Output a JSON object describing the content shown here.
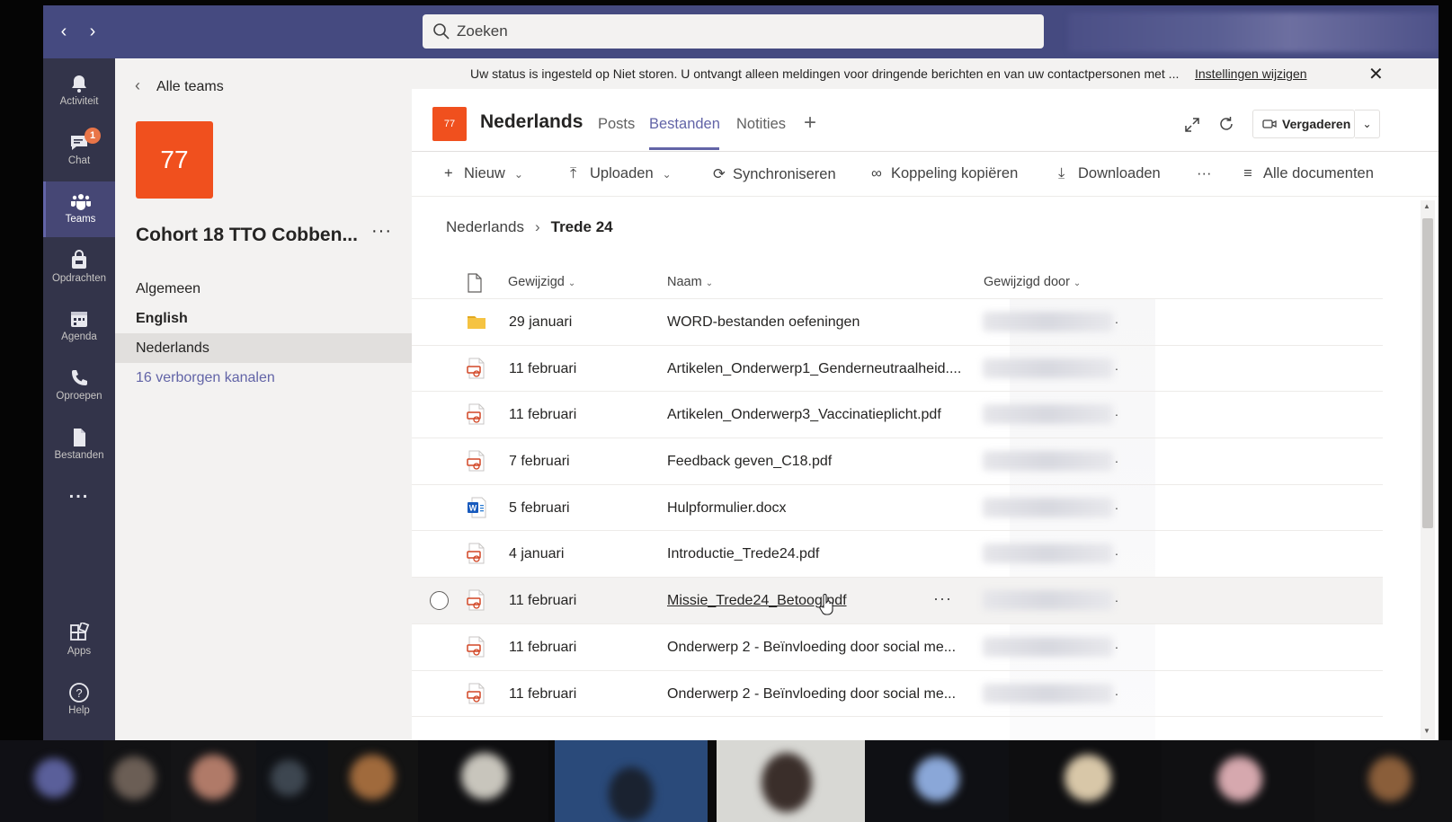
{
  "search": {
    "placeholder": "Zoeken"
  },
  "rail": {
    "items": [
      {
        "label": "Activiteit",
        "icon": "bell-icon"
      },
      {
        "label": "Chat",
        "icon": "chat-icon",
        "badge": "1"
      },
      {
        "label": "Teams",
        "icon": "teams-icon",
        "active": true
      },
      {
        "label": "Opdrachten",
        "icon": "assignments-icon"
      },
      {
        "label": "Agenda",
        "icon": "calendar-icon"
      },
      {
        "label": "Oproepen",
        "icon": "phone-icon"
      },
      {
        "label": "Bestanden",
        "icon": "files-icon"
      },
      {
        "label": "Apps",
        "icon": "apps-icon"
      },
      {
        "label": "Help",
        "icon": "help-icon"
      }
    ],
    "more": "..."
  },
  "team": {
    "back_label": "Alle teams",
    "avatar_text": "77",
    "name": "Cohort 18 TTO Cobben...",
    "more": "···",
    "channels": [
      "Algemeen",
      "English",
      "Nederlands"
    ],
    "hidden_channels": "16 verborgen kanalen"
  },
  "banner": {
    "text": "Uw status is ingesteld op Niet storen. U ontvangt alleen meldingen voor dringende berichten en van uw contactpersonen met ...",
    "link": "Instellingen wijzigen",
    "close": "✕"
  },
  "channel": {
    "avatar_text": "77",
    "title": "Nederlands",
    "tabs": [
      "Posts",
      "Bestanden",
      "Notities"
    ],
    "active_tab": "Bestanden",
    "add_tab": "+",
    "meet_label": "Vergaderen"
  },
  "commands": {
    "new": "Nieuw",
    "upload": "Uploaden",
    "sync": "Synchroniseren",
    "copy_link": "Koppeling kopiëren",
    "download": "Downloaden",
    "more": "···",
    "view": "Alle documenten"
  },
  "breadcrumb": {
    "parent": "Nederlands",
    "current": "Trede 24"
  },
  "table": {
    "headers": {
      "modified": "Gewijzigd",
      "name": "Naam",
      "modified_by": "Gewijzigd door"
    },
    "rows": [
      {
        "type": "folder",
        "modified": "29 januari",
        "name": "WORD-bestanden oefeningen"
      },
      {
        "type": "pdf",
        "modified": "11 februari",
        "name": "Artikelen_Onderwerp1_Genderneutraalheid...."
      },
      {
        "type": "pdf",
        "modified": "11 februari",
        "name": "Artikelen_Onderwerp3_Vaccinatieplicht.pdf"
      },
      {
        "type": "pdf",
        "modified": "7 februari",
        "name": "Feedback geven_C18.pdf"
      },
      {
        "type": "word",
        "modified": "5 februari",
        "name": "Hulpformulier.docx"
      },
      {
        "type": "pdf",
        "modified": "4 januari",
        "name": "Introductie_Trede24.pdf"
      },
      {
        "type": "pdf",
        "modified": "11 februari",
        "name": "Missie_Trede24_Betoog.pdf",
        "hover": true
      },
      {
        "type": "pdf",
        "modified": "11 februari",
        "name": "Onderwerp 2 - Beïnvloeding door social me..."
      },
      {
        "type": "pdf",
        "modified": "11 februari",
        "name": "Onderwerp 2 - Beïnvloeding door social me..."
      }
    ],
    "row_more": "···"
  },
  "colors": {
    "titlebar": "#454a80",
    "rail": "#33344a",
    "accent": "#6264a7",
    "team_orange": "#f0501e"
  }
}
